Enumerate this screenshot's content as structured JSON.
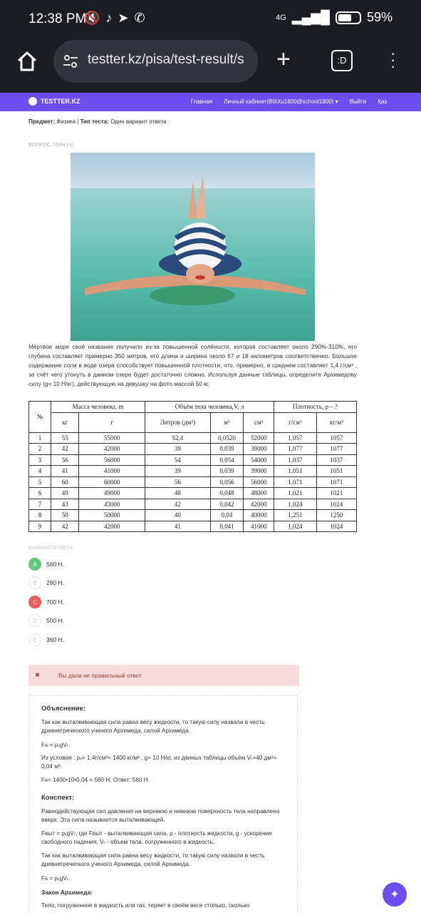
{
  "status_bar": {
    "time": "12:38 PM",
    "network": "4G",
    "battery": "59%"
  },
  "browser": {
    "url": "testter.kz/pisa/test-result/s",
    "tabs_label": ":D"
  },
  "site_nav": {
    "logo": "TESTTER.KZ",
    "links": [
      "Главная",
      "Личный кабинет(B0tXu1800@school1800) ▾",
      "Выйти",
      "Қаз"
    ]
  },
  "subject_line": {
    "subject_label": "Предмет:",
    "subject": " Физика | ",
    "type_label": "Тип теста:",
    "type": " Один вариант ответа"
  },
  "question_number": "ВОПРОС 70/84 (А)",
  "question_text": "Мёртвое море своё название получило из-за повышенной солёности, которая составляет около 290%-310%, его глубина составляет примерно 350 метров, его длина и ширина около 67 и 18 километров соответственно. Большое содержание соли в воде озера способствует повышенной плотности, что, примерно, в среднем составляет 1,4 г/см³ , за счёт чего утонуть в данном озере будет достаточно сложно. Используя данные таблицы, определите Архимедову силу (g= 10 Н/кг), действующую на девушку на фото массой 50 кг.",
  "table": {
    "head1": [
      "№",
      "Масса человека, m",
      "Объём тела человека,V, л",
      "Плотность, ρ – ?"
    ],
    "head2": [
      "кг",
      "г",
      "Литров (дм³)",
      "м³",
      "см³",
      "г/см³",
      "кг/м³"
    ],
    "rows": [
      [
        "1",
        "55",
        "55000",
        "52,4",
        "0,0520",
        "52000",
        "1,057",
        "1057"
      ],
      [
        "2",
        "42",
        "42000",
        "39",
        "0,039",
        "39000",
        "1,077",
        "1077"
      ],
      [
        "3",
        "56",
        "56000",
        "54",
        "0,054",
        "54000",
        "1,037",
        "1037"
      ],
      [
        "4",
        "41",
        "41000",
        "39",
        "0,039",
        "39000",
        "1,051",
        "1051"
      ],
      [
        "5",
        "60",
        "60000",
        "56",
        "0,056",
        "56000",
        "1,071",
        "1071"
      ],
      [
        "6",
        "49",
        "49000",
        "48",
        "0,048",
        "48000",
        "1,021",
        "1021"
      ],
      [
        "7",
        "43",
        "43000",
        "42",
        "0,042",
        "42000",
        "1,024",
        "1024"
      ],
      [
        "8",
        "50",
        "50000",
        "40",
        "0,04",
        "40000",
        "1,251",
        "1250"
      ],
      [
        "9",
        "42",
        "42000",
        "41",
        "0,041",
        "41000",
        "1,024",
        "1024"
      ]
    ]
  },
  "answers_label": "ВАРИАНТ ОТВЕТА",
  "options": [
    {
      "letter": "A",
      "text": "560 Н.",
      "state": "correct"
    },
    {
      "letter": "B",
      "text": "280 Н.",
      "state": "none"
    },
    {
      "letter": "C",
      "text": "700 Н.",
      "state": "wrong"
    },
    {
      "letter": "D",
      "text": "500 Н.",
      "state": "none"
    },
    {
      "letter": "E",
      "text": "360 Н.",
      "state": "none"
    }
  ],
  "alert": {
    "icon": "✖",
    "text": "Вы дали не правильный ответ"
  },
  "explanation": {
    "title": "Объяснение:",
    "p1": "Так как выталкивающая сила равна весу жидкости, то такую силу назвали в честь древнегреческого ученого Архимеда, силой Архимеда.",
    "p2": "Fᴀ = ρₓgVₜ.",
    "p3": "Из условия : ρₓ= 1,4г/см³= 1400 кг/м³ , g= 10 Н/кг, из данных таблицы объём Vₜ=40 дм³= 0,04 м³.",
    "p4": "Fᴀ= 1400•10•0,04 = 560 Н.      Ответ: 560 Н.",
    "title2": "Конспект:",
    "p5": "Равнодействующая сил давления на верхнюю и нижнюю поверхность тела направлена вверх. Эта сила называется выталкивающей.",
    "p6": "Fвыт = ρₓgVₜ, где Fвыт - выталкивающая сила, ρ - плотность жидкости, g - ускорение свободного падения, Vₜ - объем тела, погруженного в жидкость.",
    "p7": "Так как выталкивающая сила равна весу жидкости, то такую силу назвали в честь древнегреческого ученого Архимеда, силой Архимеда.",
    "p8": "Fᴀ = ρₓgVₜ.",
    "title3": "Закон Архимеда:",
    "p9": "Тело, погруженное в жидкость или газ, теряет в своём весе столько, сколько"
  },
  "colors": {
    "accent": "#6c4df2",
    "correct": "#63c87a",
    "wrong": "#ef5a5a",
    "alert_bg": "#f7dddd"
  }
}
